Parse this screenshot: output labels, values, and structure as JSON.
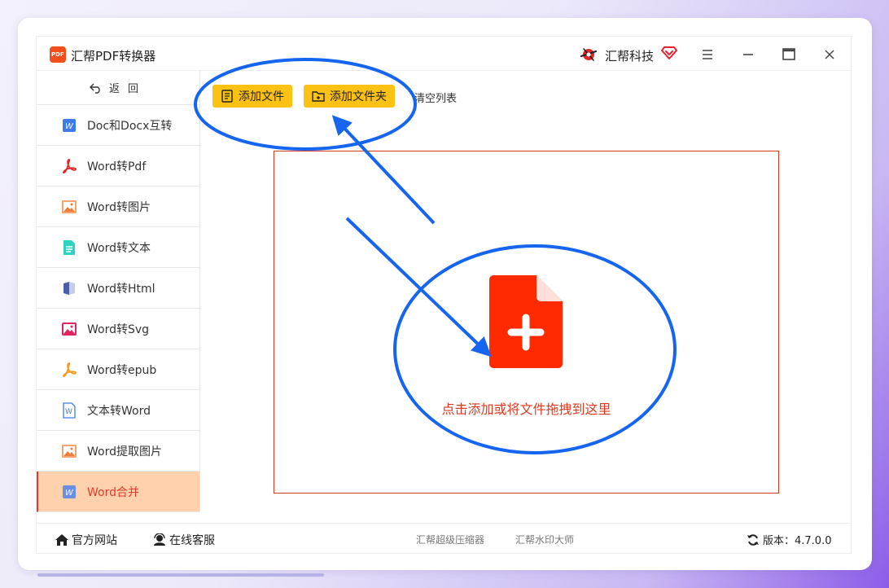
{
  "app": {
    "title": "汇帮PDF转换器",
    "logo_text": "PDF",
    "brand_name": "汇帮科技"
  },
  "sidebar": {
    "back_label": "返回",
    "items": [
      {
        "label": "Doc和Docx互转",
        "icon": "word-icon"
      },
      {
        "label": "Word转Pdf",
        "icon": "pdf-icon"
      },
      {
        "label": "Word转图片",
        "icon": "image-icon"
      },
      {
        "label": "Word转文本",
        "icon": "text-doc-icon"
      },
      {
        "label": "Word转Html",
        "icon": "book-icon"
      },
      {
        "label": "Word转Svg",
        "icon": "svg-image-icon"
      },
      {
        "label": "Word转epub",
        "icon": "epub-icon"
      },
      {
        "label": "文本转Word",
        "icon": "word-outline-icon"
      },
      {
        "label": "Word提取图片",
        "icon": "image-icon"
      },
      {
        "label": "Word合并",
        "icon": "word-icon",
        "active": true
      }
    ]
  },
  "toolbar": {
    "add_file": "添加文件",
    "add_folder": "添加文件夹",
    "clear_list": "清空列表"
  },
  "dropzone": {
    "hint": "点击添加或将文件拖拽到这里"
  },
  "footer": {
    "official_site": "官方网站",
    "online_service": "在线客服",
    "compressor": "汇帮超级压缩器",
    "watermark": "汇帮水印大师",
    "version_label": "版本：4.7.0.0"
  },
  "colors": {
    "accent_yellow": "#fbc113",
    "accent_red": "#e53a2b",
    "active_bg": "#ffd1ad",
    "annotation_blue": "#1565f0"
  }
}
